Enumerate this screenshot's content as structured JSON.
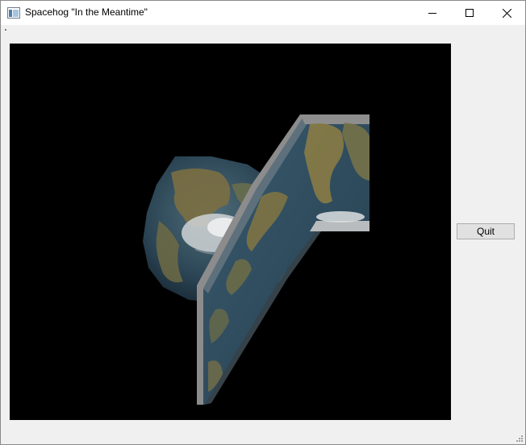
{
  "window": {
    "title": "Spacehog \"In the Meantime\""
  },
  "controls": {
    "quit_label": "Quit"
  },
  "colors": {
    "viewport_background": "#000000",
    "ocean": "#2f4f62",
    "land": "#8a7a4a",
    "ice": "#d8dadc",
    "panel_edge": "#8c8c8c"
  },
  "icons": {
    "app": "app-window-icon",
    "minimize": "minimize-icon",
    "maximize": "maximize-icon",
    "close": "close-icon",
    "size_grip": "size-grip-icon"
  }
}
